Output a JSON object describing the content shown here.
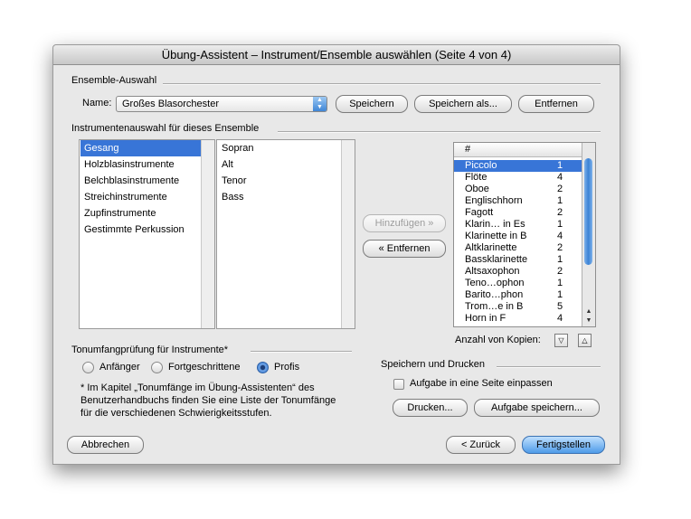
{
  "window": {
    "title": "Übung-Assistent – Instrument/Ensemble auswählen (Seite 4 von 4)"
  },
  "ensemble": {
    "section_label": "Ensemble-Auswahl",
    "name_label": "Name:",
    "selected": "Großes Blasorchester",
    "save": "Speichern",
    "save_as": "Speichern als...",
    "remove": "Entfernen"
  },
  "instruments": {
    "section_label": "Instrumentenauswahl für dieses Ensemble",
    "families": [
      "Gesang",
      "Holzblasinstrumente",
      "Belchblasinstrumente",
      "Streichinstrumente",
      "Zupfinstrumente",
      "Gestimmte Perkussion"
    ],
    "selected_family": 0,
    "voices": [
      "Sopran",
      "Alt",
      "Tenor",
      "Bass"
    ],
    "add": "Hinzufügen »",
    "remove": "« Entfernen"
  },
  "ensemble_table": {
    "header": "#",
    "rows": [
      {
        "name": "Piccolo",
        "count": "1"
      },
      {
        "name": "Flöte",
        "count": "4"
      },
      {
        "name": "Oboe",
        "count": "2"
      },
      {
        "name": "Englischhorn",
        "count": "1"
      },
      {
        "name": "Fagott",
        "count": "2"
      },
      {
        "name": "Klarin… in Es",
        "count": "1"
      },
      {
        "name": "Klarinette in B",
        "count": "4"
      },
      {
        "name": "Altklarinette",
        "count": "2"
      },
      {
        "name": "Bassklarinette",
        "count": "1"
      },
      {
        "name": "Altsaxophon",
        "count": "2"
      },
      {
        "name": "Teno…ophon",
        "count": "1"
      },
      {
        "name": "Barito…phon",
        "count": "1"
      },
      {
        "name": "Trom…e in B",
        "count": "5"
      },
      {
        "name": "Horn in F",
        "count": "4"
      }
    ],
    "selected_row": 0,
    "copies_label": "Anzahl von Kopien:"
  },
  "range_check": {
    "label": "Tonumfangprüfung für Instrumente*",
    "options": [
      "Anfänger",
      "Fortgeschrittene",
      "Profis"
    ],
    "selected": 2,
    "footnote_lines": [
      "* Im Kapitel „Tonumfänge im Übung-Assistenten“ des",
      "Benutzerhandbuchs finden Sie eine Liste der Tonumfänge",
      "für die verschiedenen Schwierigkeitsstufen."
    ]
  },
  "save_print": {
    "label": "Speichern und Drucken",
    "fit_label": "Aufgabe in eine Seite einpassen",
    "fit_checked": false,
    "print": "Drucken...",
    "save_task": "Aufgabe speichern..."
  },
  "footer": {
    "cancel": "Abbrechen",
    "back": "< Zurück",
    "finish": "Fertigstellen"
  }
}
